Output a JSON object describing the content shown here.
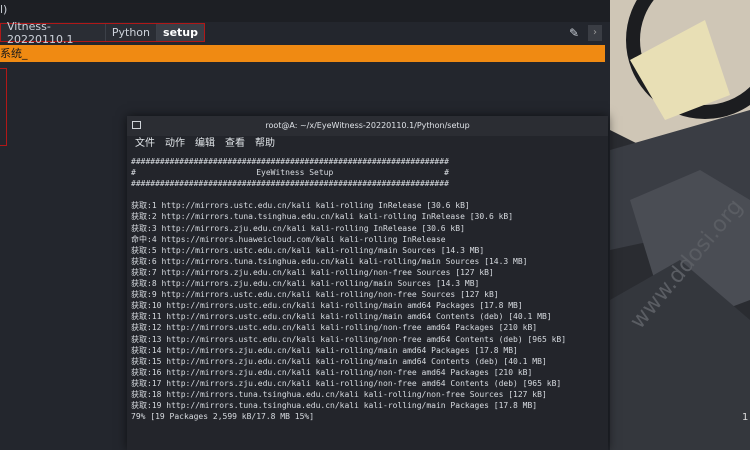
{
  "background_page": {
    "topbar_text": "l)",
    "breadcrumbs": [
      {
        "label": "Vitness-20220110.1"
      },
      {
        "label": "Python"
      },
      {
        "label": "setup"
      }
    ],
    "banner_text": "系统_"
  },
  "terminal": {
    "title": "root@A: ~/x/EyeWitness-20220110.1/Python/setup",
    "menu": [
      "文件",
      "动作",
      "编辑",
      "查看",
      "帮助"
    ],
    "lines": [
      "##################################################################",
      "#                         EyeWitness Setup                       #",
      "##################################################################",
      "",
      "获取:1 http://mirrors.ustc.edu.cn/kali kali-rolling InRelease [30.6 kB]",
      "获取:2 http://mirrors.tuna.tsinghua.edu.cn/kali kali-rolling InRelease [30.6 kB]",
      "获取:3 http://mirrors.zju.edu.cn/kali kali-rolling InRelease [30.6 kB]",
      "命中:4 https://mirrors.huaweicloud.com/kali kali-rolling InRelease",
      "获取:5 http://mirrors.ustc.edu.cn/kali kali-rolling/main Sources [14.3 MB]",
      "获取:6 http://mirrors.tuna.tsinghua.edu.cn/kali kali-rolling/main Sources [14.3 MB]",
      "获取:7 http://mirrors.zju.edu.cn/kali kali-rolling/non-free Sources [127 kB]",
      "获取:8 http://mirrors.zju.edu.cn/kali kali-rolling/main Sources [14.3 MB]",
      "获取:9 http://mirrors.ustc.edu.cn/kali kali-rolling/non-free Sources [127 kB]",
      "获取:10 http://mirrors.ustc.edu.cn/kali kali-rolling/main amd64 Packages [17.8 MB]",
      "获取:11 http://mirrors.ustc.edu.cn/kali kali-rolling/main amd64 Contents (deb) [40.1 MB]",
      "获取:12 http://mirrors.ustc.edu.cn/kali kali-rolling/non-free amd64 Packages [210 kB]",
      "获取:13 http://mirrors.ustc.edu.cn/kali kali-rolling/non-free amd64 Contents (deb) [965 kB]",
      "获取:14 http://mirrors.zju.edu.cn/kali kali-rolling/main amd64 Packages [17.8 MB]",
      "获取:15 http://mirrors.zju.edu.cn/kali kali-rolling/main amd64 Contents (deb) [40.1 MB]",
      "获取:16 http://mirrors.zju.edu.cn/kali kali-rolling/non-free amd64 Packages [210 kB]",
      "获取:17 http://mirrors.zju.edu.cn/kali kali-rolling/non-free amd64 Contents (deb) [965 kB]",
      "获取:18 http://mirrors.tuna.tsinghua.edu.cn/kali kali-rolling/non-free Sources [127 kB]",
      "获取:19 http://mirrors.tuna.tsinghua.edu.cn/kali kali-rolling/main Packages [17.8 MB]",
      "79% [19 Packages 2,599 kB/17.8 MB 15%]"
    ]
  },
  "wallpaper": {
    "watermark": "www.ddosi.org",
    "side_number": "1"
  },
  "colors": {
    "banner": "#f08a12",
    "highlight_border": "#b01818",
    "terminal_bg": "#23252b"
  }
}
